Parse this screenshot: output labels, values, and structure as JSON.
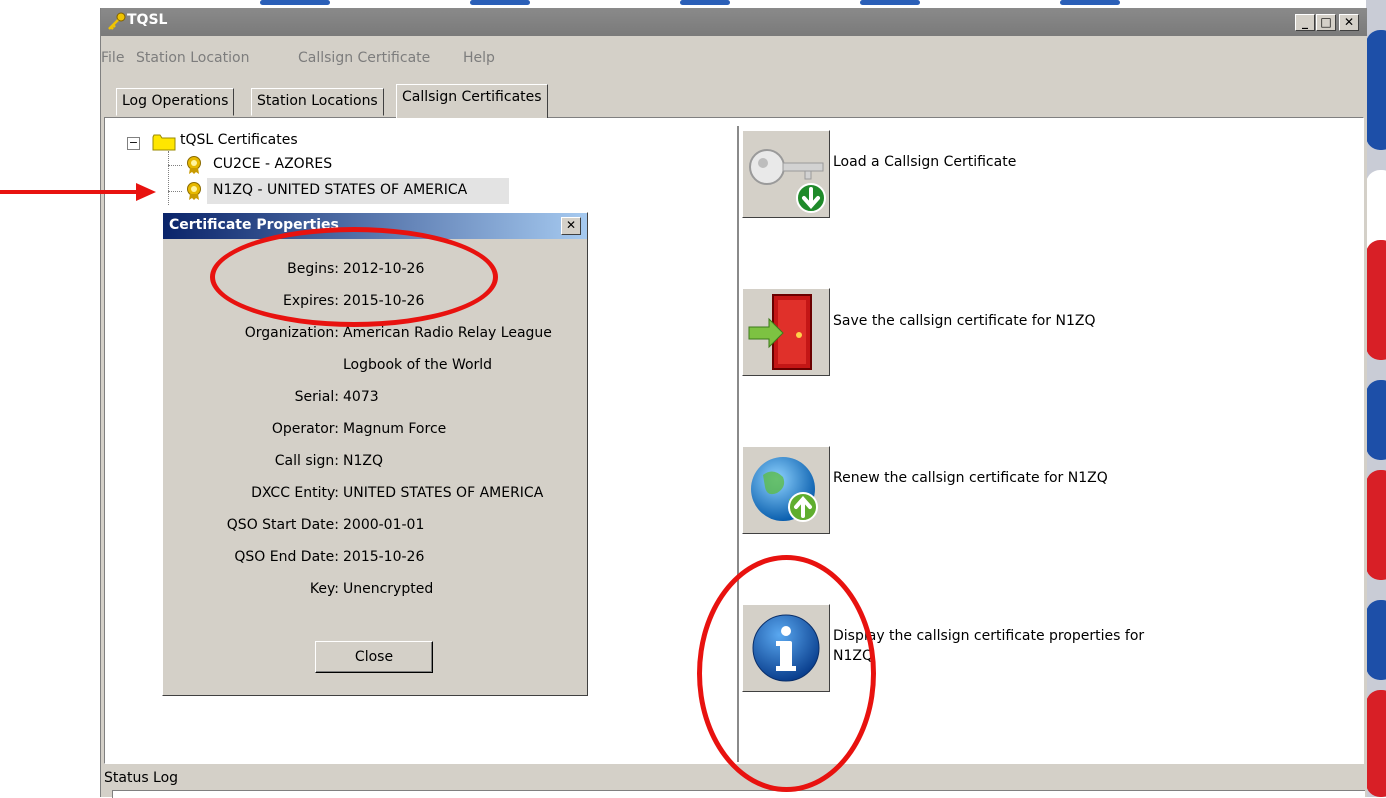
{
  "window": {
    "title": "TQSL",
    "minimize": "_",
    "maximize": "□",
    "close": "✕"
  },
  "menu": [
    "File",
    "Station Location",
    "Callsign Certificate",
    "Help"
  ],
  "tabs": [
    {
      "label": "Log Operations",
      "active": false
    },
    {
      "label": "Station Locations",
      "active": false
    },
    {
      "label": "Callsign Certificates",
      "active": true
    }
  ],
  "tree": {
    "root": "tQSL Certificates",
    "collapse_glyph": "−",
    "items": [
      "CU2CE - AZORES",
      "N1ZQ - UNITED STATES OF AMERICA"
    ],
    "selected_index": 1
  },
  "actions": [
    {
      "label": "Load a Callsign Certificate",
      "icon": "key-download-icon"
    },
    {
      "label": "Save the callsign certificate for N1ZQ",
      "icon": "door-save-icon"
    },
    {
      "label": "Renew the callsign certificate for N1ZQ",
      "icon": "globe-renew-icon"
    },
    {
      "label_lines": [
        "Display the callsign certificate properties for",
        "N1ZQ"
      ],
      "icon": "info-icon"
    }
  ],
  "dialog": {
    "title": "Certificate Properties",
    "close_glyph": "✕",
    "properties": [
      {
        "label": "Begins:",
        "value": "2012-10-26"
      },
      {
        "label": "Expires:",
        "value": "2015-10-26"
      },
      {
        "label": "Organization:",
        "value": "American Radio Relay League"
      },
      {
        "label": "",
        "value": "Logbook of the World"
      },
      {
        "label": "Serial:",
        "value": "4073"
      },
      {
        "label": "Operator:",
        "value": "Magnum Force"
      },
      {
        "label": "Call sign:",
        "value": "N1ZQ"
      },
      {
        "label": "DXCC Entity:",
        "value": "UNITED STATES OF AMERICA"
      },
      {
        "label": "QSO Start Date:",
        "value": "2000-01-01"
      },
      {
        "label": "QSO End Date:",
        "value": "2015-10-26"
      },
      {
        "label": "Key:",
        "value": "Unencrypted"
      }
    ],
    "close_button": "Close"
  },
  "status": {
    "label": "Status Log"
  },
  "colors": {
    "annotation": "#e8120f",
    "dialog_title": "#0a246a",
    "window_bg": "#d4d0c8"
  }
}
